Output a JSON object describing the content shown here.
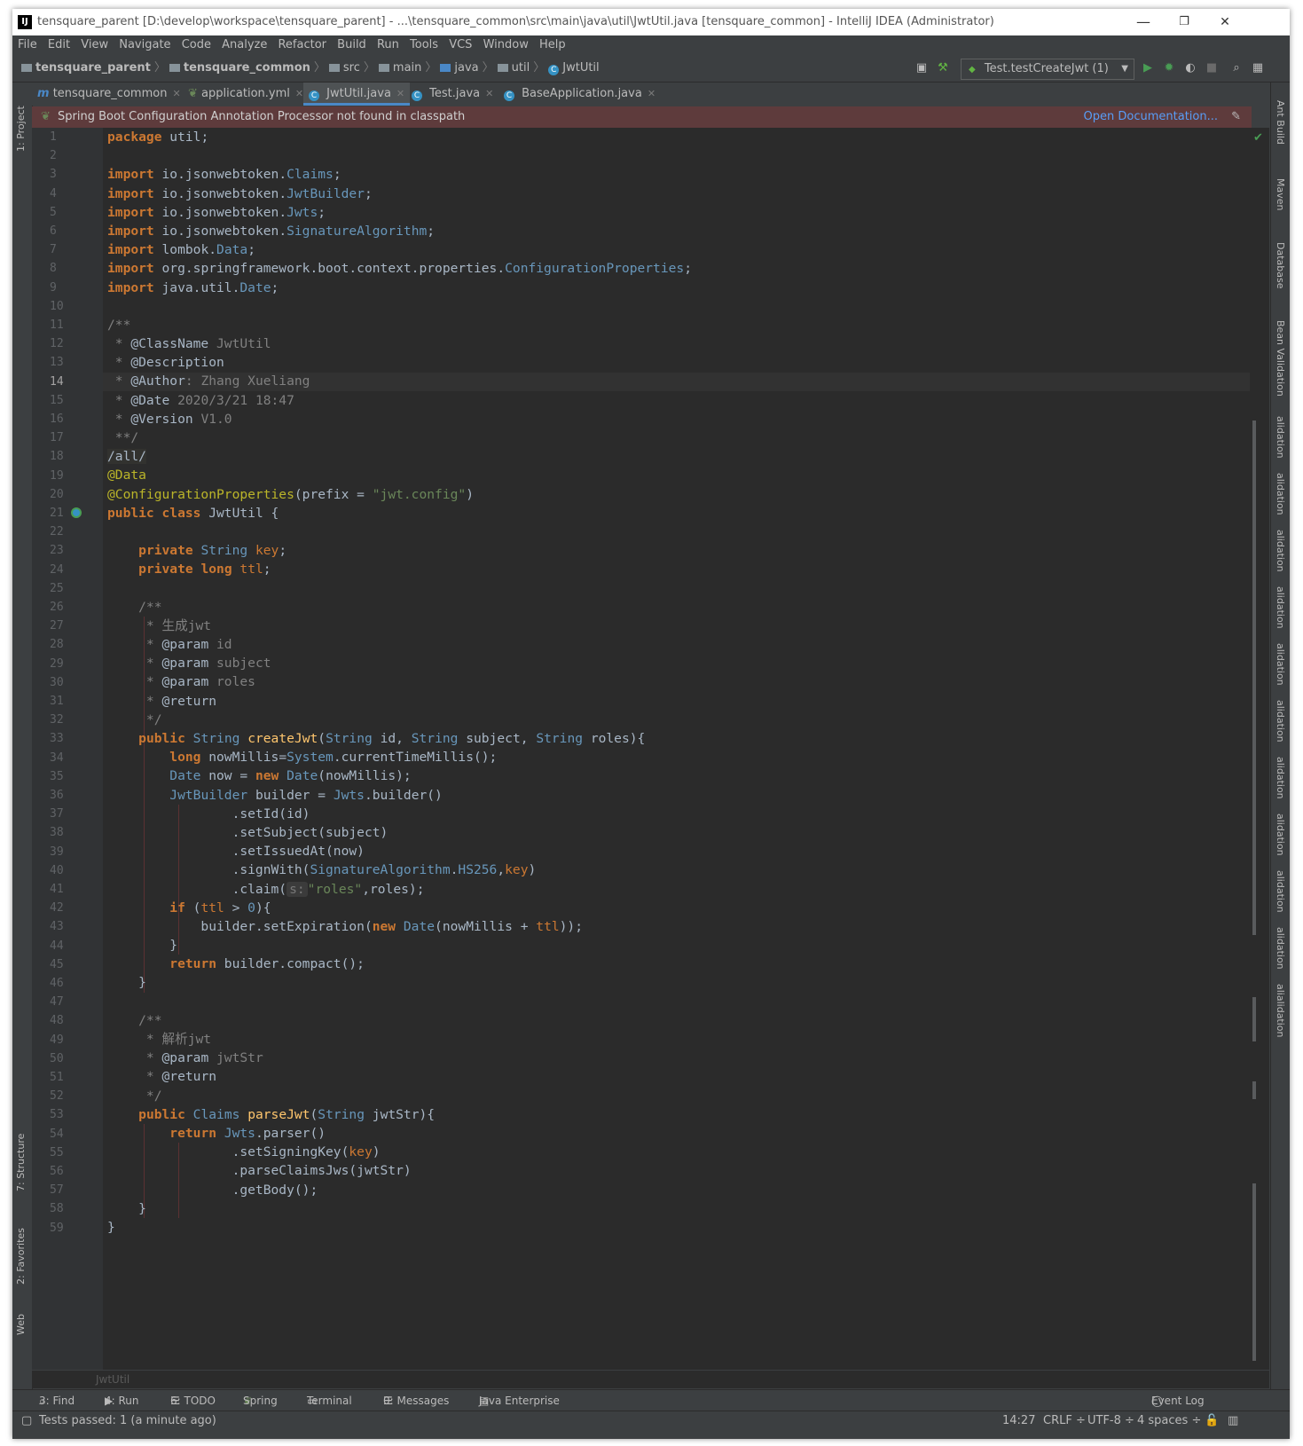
{
  "window": {
    "title": "tensquare_parent [D:\\develop\\workspace\\tensquare_parent] - ...\\tensquare_common\\src\\main\\java\\util\\JwtUtil.java [tensquare_common] - IntelliJ IDEA (Administrator)",
    "app_icon": "IJ",
    "minimize": "—",
    "restore": "❐",
    "close": "✕"
  },
  "menu": [
    "File",
    "Edit",
    "View",
    "Navigate",
    "Code",
    "Analyze",
    "Refactor",
    "Build",
    "Run",
    "Tools",
    "VCS",
    "Window",
    "Help"
  ],
  "breadcrumb": {
    "items": [
      "tensquare_parent",
      "tensquare_common",
      "src",
      "main",
      "java",
      "util",
      "JwtUtil"
    ]
  },
  "toolbar": {
    "run_config": "Test.testCreateJwt (1)"
  },
  "tabs": [
    {
      "label": "tensquare_common",
      "icon": "m"
    },
    {
      "label": "application.yml",
      "icon": "leaf"
    },
    {
      "label": "JwtUtil.java",
      "icon": "C"
    },
    {
      "label": "Test.java",
      "icon": "C"
    },
    {
      "label": "BaseApplication.java",
      "icon": "C"
    }
  ],
  "banner": {
    "message": "Spring Boot Configuration Annotation Processor not found in classpath",
    "link": "Open Documentation..."
  },
  "left_tools": [
    "1: Project",
    "7: Structure",
    "2: Favorites",
    "Web"
  ],
  "right_tools": [
    "Ant Build",
    "Maven",
    "Database",
    "Bean Validation",
    "alidation",
    "alidation",
    "alidation",
    "alidation",
    "alidation",
    "alidation",
    "alidation",
    "alidation",
    "alidation",
    "alidation",
    "alialidation"
  ],
  "editor": {
    "current_line": 14,
    "breadcrumb_footer": "JwtUtil",
    "lines": [
      "package util;",
      "",
      "import io.jsonwebtoken.Claims;",
      "import io.jsonwebtoken.JwtBuilder;",
      "import io.jsonwebtoken.Jwts;",
      "import io.jsonwebtoken.SignatureAlgorithm;",
      "import lombok.Data;",
      "import org.springframework.boot.context.properties.ConfigurationProperties;",
      "import java.util.Date;",
      "",
      "/**",
      " * @ClassName JwtUtil",
      " * @Description",
      " * @Author: Zhang Xueliang",
      " * @Date 2020/3/21 18:47",
      " * @Version V1.0",
      " **/",
      "/all/",
      "@Data",
      "@ConfigurationProperties(prefix = \"jwt.config\")",
      "public class JwtUtil {",
      "",
      "    private String key;",
      "    private long ttl;",
      "",
      "    /**",
      "     * 生成jwt",
      "     * @param id",
      "     * @param subject",
      "     * @param roles",
      "     * @return",
      "     */",
      "    public String createJwt(String id, String subject, String roles){",
      "        long nowMillis=System.currentTimeMillis();",
      "        Date now = new Date(nowMillis);",
      "        JwtBuilder builder = Jwts.builder()",
      "                .setId(id)",
      "                .setSubject(subject)",
      "                .setIssuedAt(now)",
      "                .signWith(SignatureAlgorithm.HS256,key)",
      "                .claim( s: \"roles\",roles);",
      "        if (ttl > 0){",
      "            builder.setExpiration(new Date(nowMillis + ttl));",
      "        }",
      "        return builder.compact();",
      "    }",
      "",
      "    /**",
      "     * 解析jwt",
      "     * @param jwtStr",
      "     * @return",
      "     */",
      "    public Claims parseJwt(String jwtStr){",
      "        return Jwts.parser()",
      "                .setSigningKey(key)",
      "                .parseClaimsJws(jwtStr)",
      "                .getBody();",
      "    }",
      "}"
    ]
  },
  "tool_windows": [
    {
      "key": "3",
      "label": "3: Find"
    },
    {
      "key": "4",
      "label": "4: Run"
    },
    {
      "key": "6",
      "label": "6: TODO"
    },
    {
      "key": "",
      "label": "Spring"
    },
    {
      "key": "",
      "label": "Terminal"
    },
    {
      "key": "0",
      "label": "0: Messages"
    },
    {
      "key": "",
      "label": "Java Enterprise"
    },
    {
      "key": "",
      "label": "Event Log"
    }
  ],
  "status": {
    "message": "Tests passed: 1 (a minute ago)",
    "position": "14:27",
    "line_sep": "CRLF ÷",
    "encoding": "UTF-8 ÷",
    "indent": "4 spaces ÷"
  },
  "colors": {
    "editor_bg": "#2b2b2b",
    "keyword": "#cc7832",
    "string": "#6a8759",
    "comment": "#808080",
    "annotation": "#bbb529",
    "number": "#6897bb",
    "field": "#9876aa",
    "banner_bg": "#5e3b3c",
    "link": "#589df6"
  }
}
